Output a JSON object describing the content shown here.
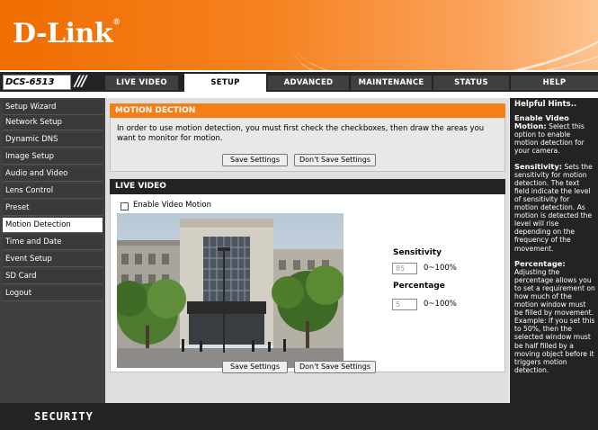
{
  "brand": {
    "logo": "D-Link",
    "model": "DCS-6513",
    "footer": "SECURITY"
  },
  "nav": {
    "slashes": "///",
    "tabs": [
      {
        "label": "LIVE VIDEO"
      },
      {
        "label": "SETUP"
      },
      {
        "label": "ADVANCED"
      },
      {
        "label": "MAINTENANCE"
      },
      {
        "label": "STATUS"
      },
      {
        "label": "HELP"
      }
    ],
    "active_tab": "SETUP"
  },
  "sidebar": {
    "items": [
      {
        "label": "Setup Wizard"
      },
      {
        "label": "Network Setup"
      },
      {
        "label": "Dynamic DNS"
      },
      {
        "label": "Image Setup"
      },
      {
        "label": "Audio and Video"
      },
      {
        "label": "Lens Control"
      },
      {
        "label": "Preset"
      },
      {
        "label": "Motion Detection"
      },
      {
        "label": "Time and Date"
      },
      {
        "label": "Event Setup"
      },
      {
        "label": "SD Card"
      },
      {
        "label": "Logout"
      }
    ],
    "active_item": "Motion Detection"
  },
  "motion": {
    "title": "MOTION DECTION",
    "description": "In order to use motion detection, you must first check the checkboxes, then draw the areas you want to monitor for motion.",
    "save_label": "Save Settings",
    "dont_save_label": "Don't Save Settings"
  },
  "live": {
    "title": "LIVE VIDEO",
    "enable_label": "Enable Video Motion",
    "enable_checked": false,
    "sensitivity": {
      "label": "Sensitivity",
      "value": "85",
      "range": "0~100%"
    },
    "percentage": {
      "label": "Percentage",
      "value": "5",
      "range": "0~100%"
    }
  },
  "bottom_buttons": {
    "save_label": "Save Settings",
    "dont_save_label": "Don't Save Settings"
  },
  "hints": {
    "title": "Helpful Hints..",
    "items": [
      {
        "term": "Enable Video Motion:",
        "text": "Select this option to enable motion detection for your camera."
      },
      {
        "term": "Sensitivity:",
        "text": "Sets the sensitivity for motion detection. The text field indicate the level of sensitivity for motion detection. As motion is detected the level will rise depending on the frequency of the movement."
      },
      {
        "term": "Percentage:",
        "text": "Adjusting the percentage allows you to set a requirement on how much of the motion window must be filled by movement. Example: If you set this to 50%, then the selected window must be half filled by a moving object before it triggers motion detection."
      }
    ]
  },
  "colors": {
    "orange": "#f57f17",
    "dark": "#232323",
    "sidebar": "#404040"
  },
  "icons": {
    "checkbox": "checkbox-icon"
  }
}
